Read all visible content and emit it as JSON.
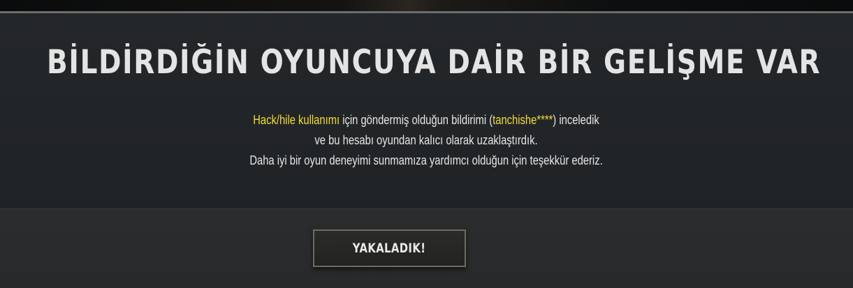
{
  "dialog": {
    "title": "BİLDİRDİĞİN OYUNCUYA DAİR BİR GELİŞME VAR",
    "message": {
      "line1_hack": "Hack/hile kullanımı",
      "line1_mid": " için göndermiş olduğun bildirimi (",
      "line1_player": "tanchishe****",
      "line1_end": ") inceledik",
      "line2": "ve bu hesabı oyundan kalıcı olarak uzaklaştırdık.",
      "line3": "Daha iyi bir oyun deneyimi sunmamıza yardımcı olduğun için teşekkür ederiz."
    },
    "highlight_color": "#f2dc3a"
  },
  "footer": {
    "ack_button_label": "YAKALADIK!"
  }
}
